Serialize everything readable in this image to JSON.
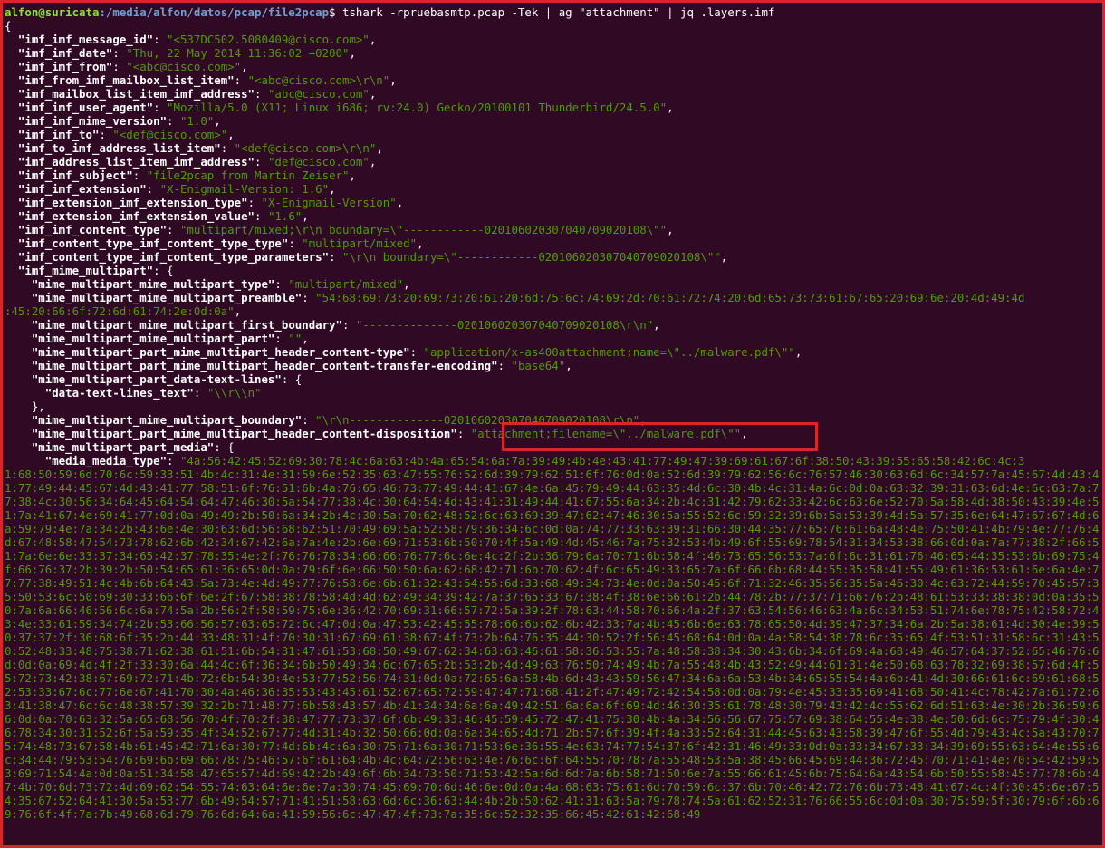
{
  "prompt": {
    "user_host": "alfon@suricata",
    "path": ":/media/alfon/datos/pcap/file2pcap",
    "symbol": "$ ",
    "command": "tshark -rpruebasmtp.pcap -Tek | ag \"attachment\" | jq .layers.imf"
  },
  "json_lines": [
    {
      "indent": "",
      "key": "",
      "value": "",
      "tail": "{"
    },
    {
      "indent": "  ",
      "key": "\"imf_imf_message_id\"",
      "value": "\"<537DC502.5080409@cisco.com>\"",
      "tail": ","
    },
    {
      "indent": "  ",
      "key": "\"imf_imf_date\"",
      "value": "\"Thu, 22 May 2014 11:36:02 +0200\"",
      "tail": ","
    },
    {
      "indent": "  ",
      "key": "\"imf_imf_from\"",
      "value": "\"<abc@cisco.com>\"",
      "tail": ","
    },
    {
      "indent": "  ",
      "key": "\"imf_from_imf_mailbox_list_item\"",
      "value": "\"<abc@cisco.com>\\r\\n\"",
      "tail": ","
    },
    {
      "indent": "  ",
      "key": "\"imf_mailbox_list_item_imf_address\"",
      "value": "\"abc@cisco.com\"",
      "tail": ","
    },
    {
      "indent": "  ",
      "key": "\"imf_imf_user_agent\"",
      "value": "\"Mozilla/5.0 (X11; Linux i686; rv:24.0) Gecko/20100101 Thunderbird/24.5.0\"",
      "tail": ","
    },
    {
      "indent": "  ",
      "key": "\"imf_imf_mime_version\"",
      "value": "\"1.0\"",
      "tail": ","
    },
    {
      "indent": "  ",
      "key": "\"imf_imf_to\"",
      "value": "\"<def@cisco.com>\"",
      "tail": ","
    },
    {
      "indent": "  ",
      "key": "\"imf_to_imf_address_list_item\"",
      "value": "\"<def@cisco.com>\\r\\n\"",
      "tail": ","
    },
    {
      "indent": "  ",
      "key": "\"imf_address_list_item_imf_address\"",
      "value": "\"def@cisco.com\"",
      "tail": ","
    },
    {
      "indent": "  ",
      "key": "\"imf_imf_subject\"",
      "value": "\"file2pcap from Martin Zeiser\"",
      "tail": ","
    },
    {
      "indent": "  ",
      "key": "\"imf_imf_extension\"",
      "value": "\"X-Enigmail-Version: 1.6\"",
      "tail": ","
    },
    {
      "indent": "  ",
      "key": "\"imf_extension_imf_extension_type\"",
      "value": "\"X-Enigmail-Version\"",
      "tail": ","
    },
    {
      "indent": "  ",
      "key": "\"imf_extension_imf_extension_value\"",
      "value": "\"1.6\"",
      "tail": ","
    },
    {
      "indent": "  ",
      "key": "\"imf_imf_content_type\"",
      "value": "\"multipart/mixed;\\r\\n boundary=\\\"------------020106020307040709020108\\\"\"",
      "tail": ","
    },
    {
      "indent": "  ",
      "key": "\"imf_content_type_imf_content_type_type\"",
      "value": "\"multipart/mixed\"",
      "tail": ","
    },
    {
      "indent": "  ",
      "key": "\"imf_content_type_imf_content_type_parameters\"",
      "value": "\"\\r\\n boundary=\\\"------------020106020307040709020108\\\"\"",
      "tail": ","
    },
    {
      "indent": "  ",
      "key": "\"imf_mime_multipart\"",
      "value": "",
      "tail": ": {"
    },
    {
      "indent": "    ",
      "key": "\"mime_multipart_mime_multipart_type\"",
      "value": "\"multipart/mixed\"",
      "tail": ","
    },
    {
      "indent": "    ",
      "key": "\"mime_multipart_mime_multipart_preamble\"",
      "value": "\"54:68:69:73:20:69:73:20:61:20:6d:75:6c:74:69:2d:70:61:72:74:20:6d:65:73:73:61:67:65:20:69:6e:20:4d:49:4d",
      "tail": ""
    },
    {
      "indent": "",
      "key": "",
      "value": ":45:20:66:6f:72:6d:61:74:2e:0d:0a\"",
      "tail": ","
    },
    {
      "indent": "    ",
      "key": "\"mime_multipart_mime_multipart_first_boundary\"",
      "value": "\"--------------020106020307040709020108\\r\\n\"",
      "tail": ","
    },
    {
      "indent": "    ",
      "key": "\"mime_multipart_mime_multipart_part\"",
      "value": "\"\"",
      "tail": ","
    },
    {
      "indent": "    ",
      "key": "\"mime_multipart_part_mime_multipart_header_content-type\"",
      "value": "\"application/x-as400attachment;name=\\\"../malware.pdf\\\"\"",
      "tail": ","
    },
    {
      "indent": "    ",
      "key": "\"mime_multipart_part_mime_multipart_header_content-transfer-encoding\"",
      "value": "\"base64\"",
      "tail": ","
    },
    {
      "indent": "    ",
      "key": "\"mime_multipart_part_data-text-lines\"",
      "value": "",
      "tail": ": {"
    },
    {
      "indent": "      ",
      "key": "\"data-text-lines_text\"",
      "value": "\"\\\\r\\\\n\"",
      "tail": ""
    },
    {
      "indent": "    ",
      "key": "",
      "value": "",
      "tail": "},"
    },
    {
      "indent": "    ",
      "key": "\"mime_multipart_mime_multipart_boundary\"",
      "value": "\"\\r\\n--------------020106020307040709020108\\r\\n\"",
      "tail": ","
    },
    {
      "indent": "    ",
      "key": "\"mime_multipart_part_mime_multipart_header_content-disposition\"",
      "value": "\"attachment;filename=\\\"../malware.pdf\\\"\"",
      "tail": ","
    },
    {
      "indent": "    ",
      "key": "\"mime_multipart_part_media\"",
      "value": "",
      "tail": ": {"
    },
    {
      "indent": "      ",
      "key": "\"media_media_type\"",
      "value": "\"4a:56:42:45:52:69:30:78:4c:6a:63:4b:4a:65:54:6a:7a:39:49:4b:4e:43:41:77:49:47:39:69:61:67:6f:38:50:43:39:55:65:58:42:6c:4c:3",
      "tail": ""
    }
  ],
  "hex_tail": "1:68:50:59:6d:70:6c:59:33:51:4b:4c:31:4e:31:59:6e:52:35:63:47:55:76:52:6d:39:79:62:51:6f:76:0d:0a:52:6d:39:79:62:56:6c:76:57:46:30:63:6d:6c:34:57:7a:45:67:4d:43:41:77:49:44:45:67:4d:43:41:77:58:51:6f:76:51:6b:4a:76:65:46:73:77:49:44:41:67:4e:6a:45:79:49:44:63:35:4d:6c:30:4b:4c:31:4a:6c:0d:0a:63:32:39:31:63:6d:4e:6c:63:7a:77:38:4c:30:56:34:64:45:64:54:64:47:46:30:5a:54:77:38:4c:30:64:54:4d:43:41:31:49:44:41:67:55:6a:34:2b:4c:31:42:79:62:33:42:6c:63:6e:52:70:5a:58:4d:38:50:43:39:4e:51:7a:41:67:4e:69:41:77:0d:0a:49:49:2b:50:6a:34:2b:4c:30:5a:70:62:48:52:6c:63:69:39:47:62:47:46:30:5a:55:52:6c:59:32:39:6b:5a:53:39:4d:5a:57:35:6e:64:47:67:67:4d:6a:59:79:4e:7a:34:2b:43:6e:4e:30:63:6d:56:68:62:51:70:49:69:5a:52:58:79:36:34:6c:0d:0a:74:77:33:63:39:31:66:30:44:35:77:65:76:61:6a:48:4e:75:50:41:4b:79:4e:77:76:4d:67:48:58:47:54:73:78:62:6b:42:34:67:42:6a:7a:4e:2b:6e:69:71:53:6b:50:70:4f:5a:49:4d:45:46:7a:75:32:53:4b:49:6f:55:69:78:54:31:34:53:38:66:0d:0a:7a:77:38:2f:66:51:7a:6e:6e:33:37:34:65:42:37:78:35:4e:2f:76:76:78:34:66:66:76:77:6c:6e:4c:2f:2b:36:79:6a:70:71:6b:58:4f:46:73:65:56:53:7a:6f:6c:31:61:76:46:65:44:35:53:6b:69:75:4f:66:76:37:2b:39:2b:50:54:65:61:36:65:0d:0a:79:6f:6e:66:50:50:6a:62:68:42:71:6b:70:62:4f:6c:65:49:33:65:7a:6f:66:6b:68:44:55:35:58:41:55:49:61:36:53:61:6e:6a:4e:77:77:38:49:51:4c:4b:6b:64:43:5a:73:4e:4d:49:77:76:58:6e:6b:61:32:43:54:55:6d:33:68:49:34:73:4e:0d:0a:50:45:6f:71:32:46:35:56:35:5a:46:30:4c:63:72:44:59:70:45:57:35:50:53:6c:50:69:30:33:66:6f:6e:2f:67:58:38:78:58:4d:4d:62:49:34:39:42:7a:37:65:33:67:38:4f:38:6e:66:61:2b:44:78:2b:77:37:71:66:76:2b:48:61:53:33:38:38:0d:0a:35:50:7a:6a:66:46:56:6c:6a:74:5a:2b:56:2f:58:59:75:6e:36:42:70:69:31:66:57:72:5a:39:2f:78:63:44:58:70:66:4a:2f:37:63:54:56:46:63:4a:6c:34:53:51:74:6e:78:75:42:58:72:43:4e:33:61:59:34:74:2b:53:66:56:57:63:65:72:6c:47:0d:0a:47:53:42:45:55:78:66:6b:62:6b:42:33:7a:4b:45:6b:6e:63:78:65:50:4d:39:47:37:34:6a:2b:5a:38:61:4d:30:4e:39:50:37:37:2f:36:68:6f:35:2b:44:33:48:31:4f:70:30:31:67:69:61:38:67:4f:73:2b:64:76:35:44:30:52:2f:56:45:68:64:0d:0a:4a:58:54:38:78:6c:35:65:4f:53:51:31:58:6c:31:43:50:52:48:33:48:75:38:71:62:38:61:51:6b:54:31:47:61:53:68:50:49:67:62:34:63:63:46:61:58:36:53:55:7a:48:58:38:34:30:43:6b:34:6f:69:4a:68:49:46:57:64:37:52:65:46:76:6d:0d:0a:69:4d:4f:2f:33:30:6a:44:4c:6f:36:34:6b:50:49:34:6c:67:65:2b:53:2b:4d:49:63:76:50:74:49:4b:7a:55:48:4b:43:52:49:44:61:31:4e:50:68:63:78:32:69:38:57:6d:4f:55:72:73:42:38:67:69:72:71:4b:72:6b:54:39:4e:53:77:52:56:74:31:0d:0a:72:65:6a:58:4b:6d:43:43:59:56:47:34:6a:6a:53:4b:34:65:55:54:4a:6b:41:4d:30:66:61:6c:69:61:68:52:53:33:67:6c:77:6e:67:41:70:30:4a:46:36:35:53:43:45:61:52:67:65:72:59:47:47:71:68:41:2f:47:49:72:42:54:58:0d:0a:79:4e:45:33:35:69:41:68:50:41:4c:78:42:7a:61:72:63:41:38:47:6c:6c:48:38:57:39:32:2b:71:48:77:6b:58:43:57:4b:41:34:34:6a:6a:49:42:51:6a:6a:6f:69:4d:46:30:35:61:78:48:30:79:43:42:4c:55:62:6d:51:63:4e:30:2b:36:59:66:0d:0a:70:63:32:5a:65:68:56:70:4f:70:2f:38:47:77:73:37:6f:6b:49:33:46:45:59:45:72:47:41:75:30:4b:4a:34:56:56:67:75:57:69:38:64:55:4e:38:4e:50:6d:6c:75:79:4f:30:46:78:34:30:31:52:6f:5a:59:35:4f:34:52:67:77:4d:31:4b:32:50:66:0d:0a:6a:34:65:4d:71:2b:57:6f:39:4f:4a:33:52:64:31:44:45:63:43:58:39:47:6f:55:4d:79:43:4c:5a:43:70:75:74:48:73:67:58:4b:61:45:42:71:6a:30:77:4d:6b:4c:6a:30:75:71:6a:30:71:53:6e:36:55:4e:63:74:77:54:37:6f:42:31:46:49:33:0d:0a:33:34:67:33:34:39:69:55:63:64:4e:55:6c:34:44:79:53:54:76:69:6b:69:66:78:75:46:57:6f:61:64:4b:4c:64:72:56:63:4e:76:6c:6f:64:55:70:78:7a:55:48:53:5a:38:45:66:45:69:44:36:72:45:70:71:41:4e:70:54:42:59:53:69:71:54:4a:0d:0a:51:34:58:47:65:57:4d:69:42:2b:49:6f:6b:34:73:50:71:53:42:5a:6d:6d:7a:6b:58:71:50:6e:7a:55:66:61:45:6b:75:64:6a:43:54:6b:50:55:58:45:77:78:6b:47:4b:70:6d:73:72:4d:69:62:54:55:74:63:64:6e:6e:7a:30:74:45:69:70:6d:46:6e:0d:0a:4a:68:63:75:61:6d:70:59:6c:37:6b:70:46:42:72:76:6b:73:48:41:67:4c:4f:30:45:6e:67:54:35:67:52:64:41:30:5a:53:77:6b:49:54:57:71:41:51:58:63:6d:6c:36:63:44:4b:2b:50:62:41:31:63:5a:79:78:74:5a:61:62:52:31:76:66:55:6c:0d:0a:30:75:59:5f:30:79:6f:6b:69:76:6f:4f:7a:7b:49:68:6d:79:76:6d:64:6a:41:59:56:6c:47:47:4f:73:7a:35:6c:52:32:35:66:45:42:61:42:68:49"
}
